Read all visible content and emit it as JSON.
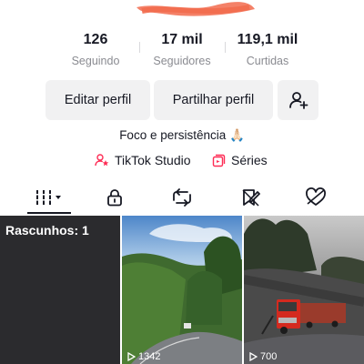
{
  "profile": {
    "stats": [
      {
        "value": "126",
        "label": "Seguindo"
      },
      {
        "value": "17 mil",
        "label": "Seguidores"
      },
      {
        "value": "119,1 mil",
        "label": "Curtidas"
      }
    ],
    "buttons": {
      "edit": "Editar perfil",
      "share": "Partilhar perfil",
      "add_friend_icon": "add-user-icon"
    },
    "bio": "Foco e persistência 🙏🏻",
    "links": {
      "studio": "TikTok Studio",
      "series": "Séries"
    }
  },
  "tabs": [
    {
      "name": "videos",
      "icon": "grid-icon",
      "active": true
    },
    {
      "name": "private",
      "icon": "lock-icon"
    },
    {
      "name": "reposts",
      "icon": "repost-icon"
    },
    {
      "name": "saved",
      "icon": "bookmark-icon"
    },
    {
      "name": "liked",
      "icon": "heart-icon"
    }
  ],
  "grid": {
    "drafts_label": "Rascunhos: 1",
    "videos": [
      {
        "views": "1342"
      },
      {
        "views": "700"
      }
    ]
  },
  "colors": {
    "text": "#161823",
    "secondary": "#8a8b91",
    "button_bg": "#f1f1f2",
    "studio_accent": "#fe2c55",
    "redaction": "#f26b4e"
  }
}
